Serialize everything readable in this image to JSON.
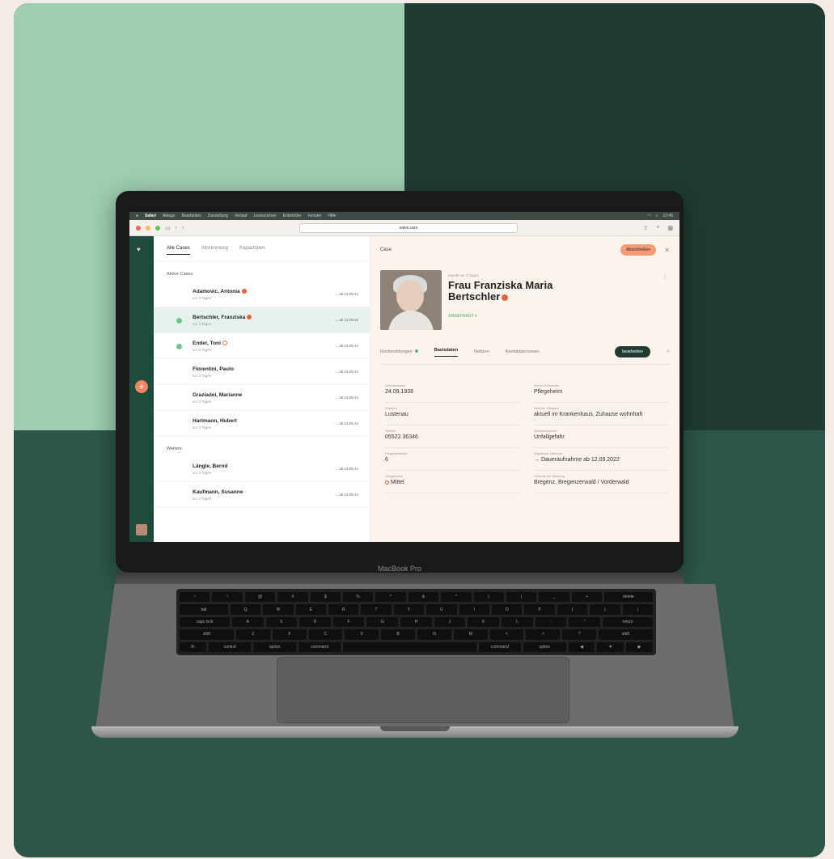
{
  "menubar": {
    "apple_icon": "apple-icon",
    "app": "Safari",
    "items": [
      "Ablage",
      "Bearbeiten",
      "Darstellung",
      "Verlauf",
      "Lesezeichen",
      "Entwickler",
      "Fenster",
      "Hilfe"
    ],
    "clock": "12:45"
  },
  "browser": {
    "url": "salve.care"
  },
  "rail": {
    "add_label": "+"
  },
  "list": {
    "tabs": [
      "Alle Cases",
      "Abstimmung",
      "Kapazitäten"
    ],
    "section_active": "Aktive Cases",
    "active_cases": [
      {
        "name": "Adamovic, Antonia",
        "sub": "vor 3 Tagen",
        "date": "→ ab 23.08.22",
        "warn": "filled"
      },
      {
        "name": "Bertschler, Franziska",
        "sub": "vor 3 Tagen",
        "date": "→ ab 12.09.22",
        "warn": "filled",
        "selected": true
      },
      {
        "name": "Ender, Toni",
        "sub": "vor 3 Tagen",
        "date": "→ ab 23.08.22",
        "warn": "outline"
      },
      {
        "name": "Florentini, Paulo",
        "sub": "vor 3 Tagen",
        "date": "→ ab 23.08.22"
      },
      {
        "name": "Graziadei, Marianne",
        "sub": "vor 3 Tagen",
        "date": "→ ab 23.08.22"
      },
      {
        "name": "Hartmann, Hubert",
        "sub": "vor 3 Tagen",
        "date": "→ ab 23.08.22"
      }
    ],
    "section_more": "Weitere",
    "more_cases": [
      {
        "name": "Längle, Bernd",
        "sub": "vor 3 Tagen",
        "date": "→ ab 23.08.22"
      },
      {
        "name": "Kaufmann, Susanne",
        "sub": "vor 3 Tagen",
        "date": "→ ab 23.08.22"
      }
    ]
  },
  "detail": {
    "header": "Case",
    "close_button": "Abschließen",
    "meta": "erstellt vor 3 Tagen",
    "name_line1": "Frau Franziska Maria",
    "name_line2": "Bertschler",
    "status": "ANGEFRAGT ▾",
    "tabs": [
      "Rückmeldungen",
      "Basisdaten",
      "Notizen",
      "Kontaktpersonen"
    ],
    "edit_button": "bearbeiten",
    "fields_left": [
      {
        "label": "Geburtsdatum",
        "value": "24.09.1938"
      },
      {
        "label": "Wohnort",
        "value": "Lustenau"
      },
      {
        "label": "Telefon",
        "value": "05522 36346"
      },
      {
        "label": "Pflegegeldstufe",
        "value": "6"
      },
      {
        "label": "Dringlichkeit",
        "value": "Mittel"
      }
    ],
    "fields_right": [
      {
        "label": "Art der Aufnahme",
        "value": "Pflegeheim"
      },
      {
        "label": "Aktuelle Situation",
        "value": "aktuell im Krankenhaus, Zuhause wohnhaft"
      },
      {
        "label": "Aufnahmegrund",
        "value": "Unfallgefahr"
      },
      {
        "label": "Aufnahme Zeitraum",
        "value": "→ Daueraufnahme ab 12.09.2022"
      },
      {
        "label": "Umkreis der Meldung",
        "value": "Bregenz, Bregenzerwald / Vorderwald"
      }
    ]
  },
  "laptop": {
    "brand": "MacBook Pro"
  },
  "keyboard_rows": [
    [
      "~",
      "!",
      "@",
      "#",
      "$",
      "%",
      "^",
      "&",
      "*",
      "(",
      ")",
      "_",
      "+",
      "delete"
    ],
    [
      "tab",
      "Q",
      "W",
      "E",
      "R",
      "T",
      "Y",
      "U",
      "I",
      "O",
      "P",
      "{",
      "}",
      "|"
    ],
    [
      "caps lock",
      "A",
      "S",
      "D",
      "F",
      "G",
      "H",
      "J",
      "K",
      "L",
      ":",
      "\"",
      "return"
    ],
    [
      "shift",
      "Z",
      "X",
      "C",
      "V",
      "B",
      "N",
      "M",
      "<",
      ">",
      "?",
      "shift"
    ],
    [
      "fn",
      "control",
      "option",
      "command",
      "",
      "command",
      "option",
      "◀",
      "▼",
      "▶"
    ]
  ]
}
